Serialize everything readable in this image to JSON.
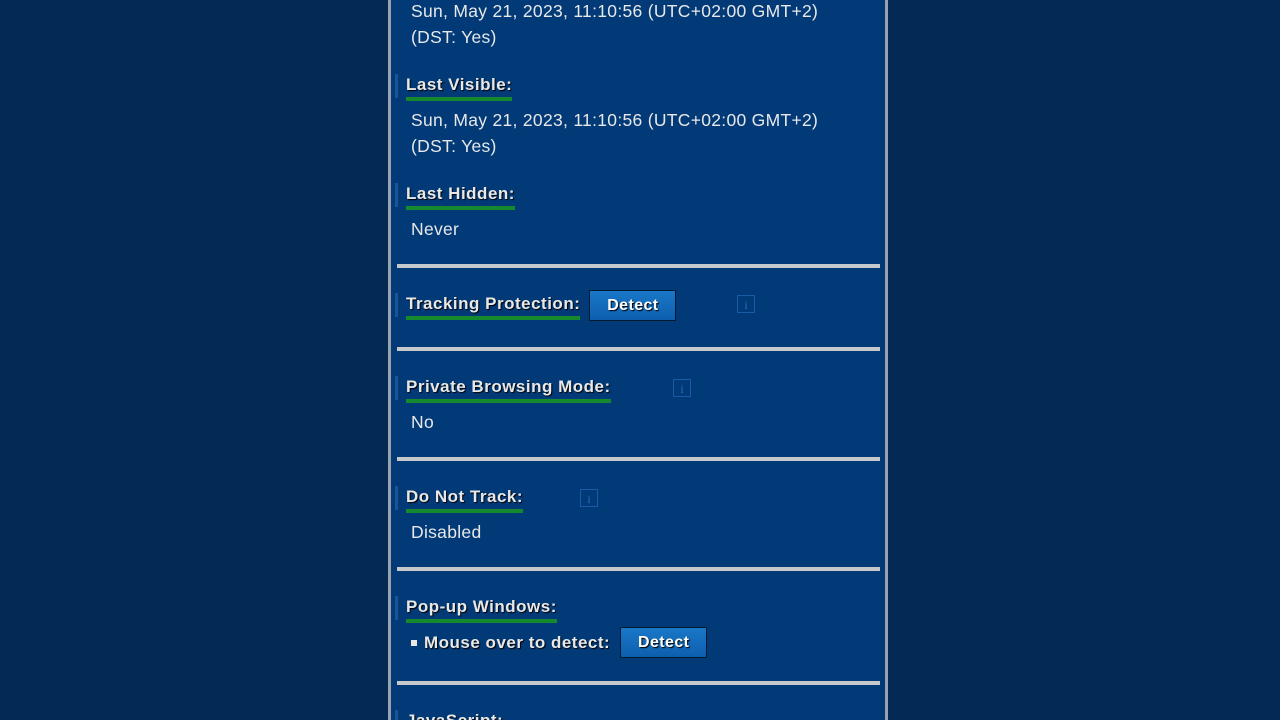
{
  "sections": {
    "first_visible": {
      "value_line1": "Sun, May 21, 2023, 11:10:56  (UTC+02:00 GMT+2)",
      "value_line2": "(DST: Yes)"
    },
    "last_visible": {
      "label": "Last Visible:",
      "value_line1": "Sun, May 21, 2023, 11:10:56  (UTC+02:00 GMT+2)",
      "value_line2": "(DST: Yes)"
    },
    "last_hidden": {
      "label": "Last Hidden:",
      "value": "Never"
    },
    "tracking_protection": {
      "label": "Tracking Protection:",
      "button": "Detect",
      "info_icon": "i"
    },
    "private_browsing": {
      "label": "Private Browsing Mode:",
      "value": "No",
      "info_icon": "i"
    },
    "do_not_track": {
      "label": "Do Not Track:",
      "value": "Disabled",
      "info_icon": "i"
    },
    "popup_windows": {
      "label": "Pop-up Windows:",
      "bullet_label": "Mouse over to detect:",
      "button": "Detect"
    },
    "javascript": {
      "label": "JavaScript:"
    }
  },
  "colors": {
    "page_background": "#022a55",
    "panel_background": "#023a78",
    "heading_underline": "#15892e",
    "button": "#1a77c8",
    "separator": "#c5c8cc"
  }
}
